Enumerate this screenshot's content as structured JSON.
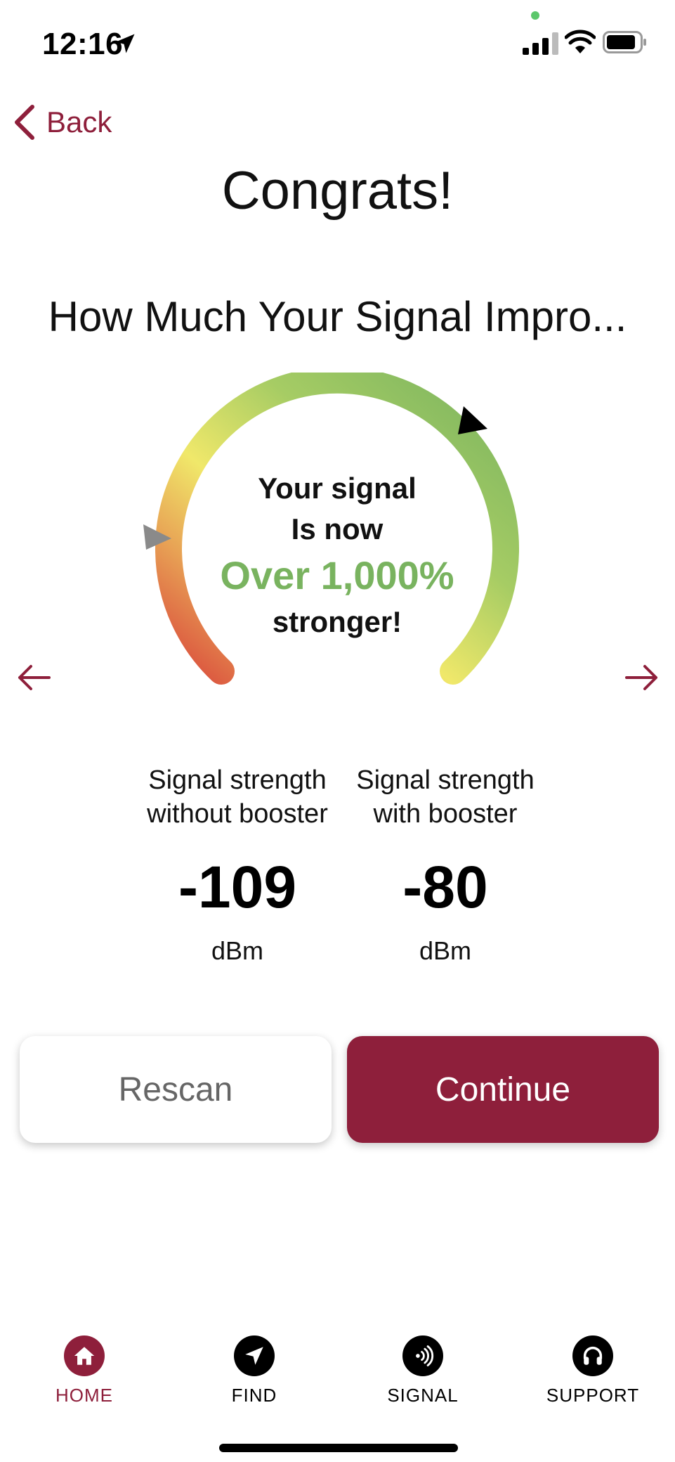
{
  "status_bar": {
    "time": "12:16"
  },
  "nav": {
    "back_label": "Back"
  },
  "header": {
    "title": "Congrats!",
    "subtitle": "How Much Your Signal Impro..."
  },
  "gauge": {
    "line1": "Your signal",
    "line2": "Is now",
    "percent_text": "Over 1,000%",
    "line4": "stronger!",
    "colors": {
      "green": "#79b35f",
      "yellow": "#f0e86a",
      "red": "#d9473b",
      "marker_before": "#8a8a8a",
      "marker_after": "#000000"
    }
  },
  "stats": {
    "without": {
      "label_line1": "Signal strength",
      "label_line2": "without booster",
      "value": "-109",
      "unit": "dBm"
    },
    "with": {
      "label_line1": "Signal strength",
      "label_line2": "with booster",
      "value": "-80",
      "unit": "dBm"
    }
  },
  "buttons": {
    "rescan_label": "Rescan",
    "continue_label": "Continue"
  },
  "tabs": [
    {
      "label": "HOME",
      "icon": "home-icon",
      "active": true
    },
    {
      "label": "FIND",
      "icon": "navigation-arrow-icon",
      "active": false
    },
    {
      "label": "SIGNAL",
      "icon": "signal-waves-icon",
      "active": false
    },
    {
      "label": "SUPPORT",
      "icon": "headphones-icon",
      "active": false
    }
  ],
  "accent_color": "#8e1f3b"
}
